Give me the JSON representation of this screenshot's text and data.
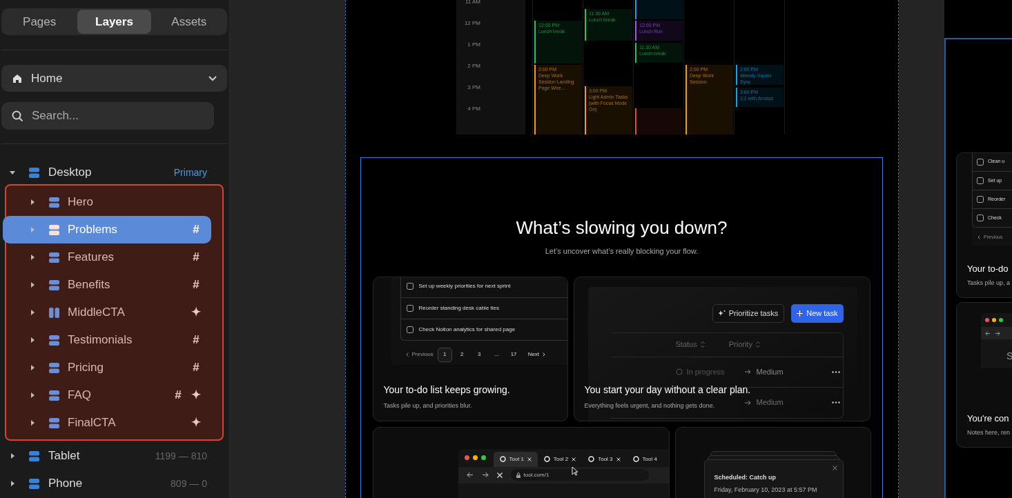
{
  "sidebar": {
    "tabs": [
      {
        "label": "Pages",
        "selected": false
      },
      {
        "label": "Layers",
        "selected": true
      },
      {
        "label": "Assets",
        "selected": false
      }
    ],
    "page_select": {
      "value": "Home"
    },
    "search": {
      "placeholder": "Search..."
    },
    "layers": [
      {
        "name": "Desktop",
        "kind": "stack",
        "expanded": true,
        "tag": "Primary",
        "children_highlighted": true,
        "children": [
          {
            "name": "Hero",
            "kind": "stack",
            "expanded": false,
            "selected": false
          },
          {
            "name": "Problems",
            "kind": "stack",
            "expanded": false,
            "selected": true,
            "badges": [
              "#"
            ]
          },
          {
            "name": "Features",
            "kind": "stack",
            "expanded": false,
            "selected": false,
            "badges": [
              "#"
            ]
          },
          {
            "name": "Benefits",
            "kind": "stack",
            "expanded": false,
            "selected": false,
            "badges": [
              "#"
            ]
          },
          {
            "name": "MiddleCTA",
            "kind": "columns",
            "expanded": false,
            "selected": false,
            "badges": [
              "✦"
            ]
          },
          {
            "name": "Testimonials",
            "kind": "stack",
            "expanded": false,
            "selected": false,
            "badges": [
              "#"
            ]
          },
          {
            "name": "Pricing",
            "kind": "stack",
            "expanded": false,
            "selected": false,
            "badges": [
              "#"
            ]
          },
          {
            "name": "FAQ",
            "kind": "stack",
            "expanded": false,
            "selected": false,
            "badges": [
              "#",
              "✦"
            ]
          },
          {
            "name": "FinalCTA",
            "kind": "stack",
            "expanded": false,
            "selected": false,
            "badges": [
              "✦"
            ]
          }
        ]
      },
      {
        "name": "Tablet",
        "kind": "stack",
        "expanded": false,
        "range": "1199 — 810"
      },
      {
        "name": "Phone",
        "kind": "stack",
        "expanded": false,
        "range": "809 — 0"
      }
    ]
  },
  "calendar": {
    "hours": [
      "11 AM",
      "12 PM",
      "1 PM",
      "2 PM",
      "3 PM",
      "4 PM"
    ],
    "events": [
      {
        "time": "11:30 AM",
        "title": "Lunch break",
        "color": "#22c55e"
      },
      {
        "time": "12:00 PM",
        "title": "Lunch break",
        "color": "#22c55e"
      },
      {
        "color": "#0ea5e9"
      },
      {
        "time": "12:00 PM",
        "title": "Lunch Run",
        "color": "#a855f7"
      },
      {
        "time": "11:30 AM",
        "title": "Lunch break",
        "color": "#22c55e"
      },
      {
        "time": "2:00 PM",
        "title": "Deep Work Session Landing Page Wire...",
        "color": "#f59e0b"
      },
      {
        "time": "3:00 PM",
        "title": "Light Admin Tasks (with Focus Mode On)",
        "color": "#f59e0b"
      },
      {
        "color": "#ef4444"
      },
      {
        "time": "2:00 PM",
        "title": "Deep Work Session",
        "color": "#f59e0b"
      },
      {
        "time": "2:00 PM",
        "title": "Weekly Squad Sync",
        "color": "#0ea5e9"
      },
      {
        "time": "3:00 PM",
        "title": "1:1 with Arnaud",
        "color": "#0ea5e9"
      }
    ]
  },
  "section": {
    "title": "What’s slowing you down?",
    "subtitle": "Let’s uncover what’s really blocking your flow.",
    "cards": [
      {
        "kind": "todo",
        "title": "Your to-do list keeps growing.",
        "description": "Tasks pile up, and priorities blur.",
        "tasks": [
          {
            "label": "Set up weekly priorities for next sprint",
            "checked": false
          },
          {
            "label": "Reorder standing desk cable ties",
            "checked": false
          },
          {
            "label": "Check Notion analytics for shared page",
            "checked": false
          }
        ],
        "pagination": {
          "previous": "Previous",
          "pages": [
            {
              "label": "1",
              "selected": true
            },
            {
              "label": "2",
              "selected": false
            },
            {
              "label": "3",
              "selected": false
            },
            {
              "label": "...",
              "selected": false
            },
            {
              "label": "17",
              "selected": false
            }
          ],
          "next": "Next"
        }
      },
      {
        "kind": "plan",
        "title": "You start your day without a clear plan.",
        "description": "Everything feels urgent, and nothing gets done.",
        "buttons": [
          "Prioritize tasks",
          "New task"
        ],
        "columns": [
          "Status",
          "Priority"
        ],
        "rows": [
          {
            "status": "In progress",
            "priority": "Medium"
          },
          {
            "priority": "Medium"
          }
        ]
      },
      {
        "kind": "browser",
        "tabs": [
          {
            "label": "Tool 1",
            "selected": true
          },
          {
            "label": "Tool 2",
            "selected": false
          },
          {
            "label": "Tool 3",
            "selected": false
          },
          {
            "label": "Tool 4",
            "selected": false
          }
        ],
        "url": "tool.com/1"
      },
      {
        "kind": "notification",
        "title": "Scheduled: Catch up",
        "time": "Friday, February 10, 2023 at 5:57 PM"
      }
    ]
  },
  "tablet_frame": {
    "cards": [
      {
        "kind": "todo",
        "tasks": [
          {
            "label": "Clean u",
            "checked": false
          },
          {
            "label": "Set up",
            "checked": false
          },
          {
            "label": "Reorder",
            "checked": false
          },
          {
            "label": "Check",
            "checked": false
          }
        ],
        "previous": "Previous",
        "title": "Your to-do",
        "description": "Tasks pile up, a"
      },
      {
        "kind": "browser",
        "letter": "S",
        "title": "You're con",
        "description": "Notes here, ren"
      }
    ]
  }
}
